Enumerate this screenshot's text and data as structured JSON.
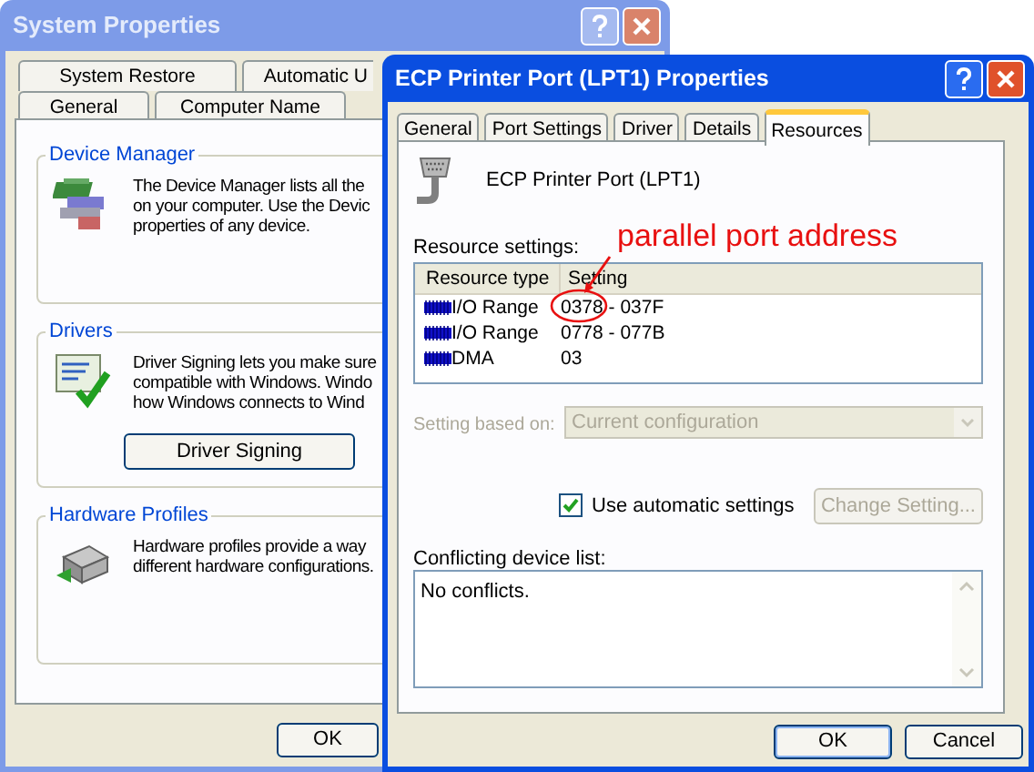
{
  "system_properties": {
    "title": "System Properties",
    "active": false,
    "tab_rows": [
      [
        {
          "label": "System Restore",
          "selected": false
        },
        {
          "label": "Automatic U",
          "selected": false
        }
      ],
      [
        {
          "label": "General",
          "selected": false
        },
        {
          "label": "Computer Name",
          "selected": false
        }
      ]
    ],
    "groups": [
      {
        "kind": "devices",
        "title": "Device Manager",
        "lines": [
          "The Device Manager lists all the",
          "on your computer. Use the Devic",
          "properties of any device."
        ]
      },
      {
        "kind": "signing",
        "title": "Drivers",
        "lines": [
          "Driver Signing lets you make sure",
          "compatible with Windows. Windo",
          "how Windows connects to Wind"
        ],
        "buttons": [
          "Driver Signing"
        ]
      },
      {
        "kind": "profiles",
        "title": "Hardware Profiles",
        "lines": [
          "Hardware profiles provide a way",
          "different hardware configurations."
        ]
      }
    ],
    "buttons": [
      "OK"
    ]
  },
  "port_properties": {
    "title": "ECP Printer Port (LPT1) Properties",
    "active": true,
    "tabs": [
      {
        "label": "General",
        "selected": false
      },
      {
        "label": "Port Settings",
        "selected": false
      },
      {
        "label": "Driver",
        "selected": false
      },
      {
        "label": "Details",
        "selected": false
      },
      {
        "label": "Resources",
        "selected": true
      }
    ],
    "device_name": "ECP Printer Port (LPT1)",
    "resource_settings_label": "Resource settings:",
    "columns": [
      "Resource type",
      "Setting"
    ],
    "rows": [
      {
        "type": "I/O Range",
        "setting": "0378 - 037F"
      },
      {
        "type": "I/O Range",
        "setting": "0778 - 077B"
      },
      {
        "type": "DMA",
        "setting": "03"
      }
    ],
    "annotation": {
      "text": "parallel port address"
    },
    "setting_based_on": {
      "label": "Setting based on:",
      "value": "Current configuration",
      "disabled": true
    },
    "automatic_settings": {
      "label": "Use automatic settings",
      "checked": true
    },
    "change_setting": {
      "label": "Change Setting...",
      "disabled": true
    },
    "conflicts_label": "Conflicting device list:",
    "conflicts": "No conflicts.",
    "buttons": [
      "OK",
      "Cancel"
    ]
  }
}
